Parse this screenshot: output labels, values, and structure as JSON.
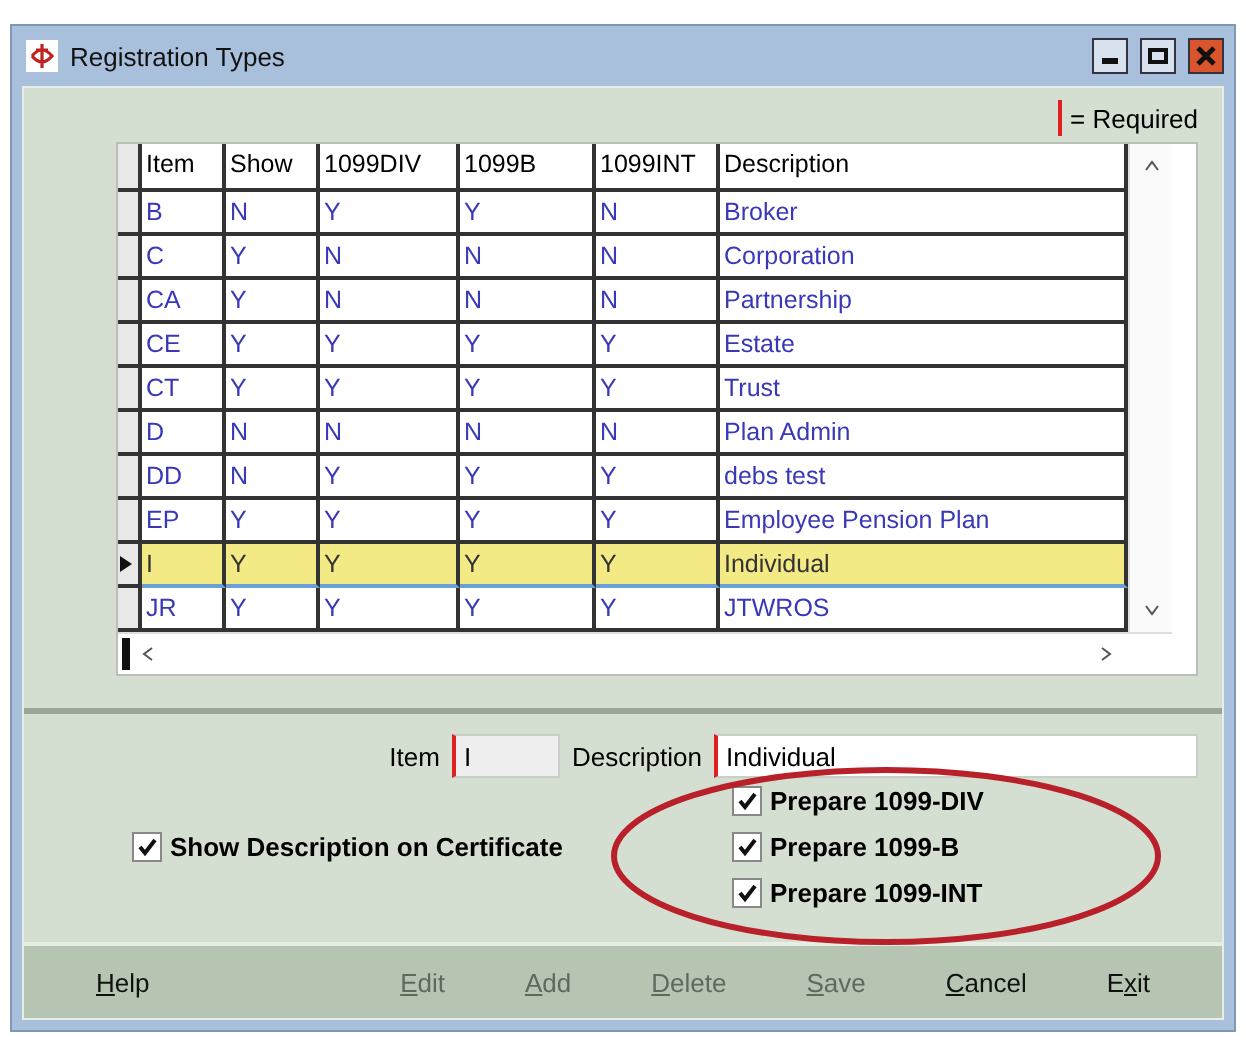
{
  "window": {
    "title": "Registration Types"
  },
  "legend": {
    "text": "= Required"
  },
  "table": {
    "columns": [
      "Item",
      "Show",
      "1099DIV",
      "1099B",
      "1099INT",
      "Description"
    ],
    "rows": [
      {
        "cells": [
          "B",
          "N",
          "Y",
          "Y",
          "N",
          "Broker"
        ],
        "selected": false
      },
      {
        "cells": [
          "C",
          "Y",
          "N",
          "N",
          "N",
          "Corporation"
        ],
        "selected": false
      },
      {
        "cells": [
          "CA",
          "Y",
          "N",
          "N",
          "N",
          "Partnership"
        ],
        "selected": false
      },
      {
        "cells": [
          "CE",
          "Y",
          "Y",
          "Y",
          "Y",
          "Estate"
        ],
        "selected": false
      },
      {
        "cells": [
          "CT",
          "Y",
          "Y",
          "Y",
          "Y",
          "Trust"
        ],
        "selected": false
      },
      {
        "cells": [
          "D",
          "N",
          "N",
          "N",
          "N",
          "Plan Admin"
        ],
        "selected": false
      },
      {
        "cells": [
          "DD",
          "N",
          "Y",
          "Y",
          "Y",
          "debs test"
        ],
        "selected": false
      },
      {
        "cells": [
          "EP",
          "Y",
          "Y",
          "Y",
          "Y",
          "Employee Pension Plan"
        ],
        "selected": false
      },
      {
        "cells": [
          "I",
          "Y",
          "Y",
          "Y",
          "Y",
          "Individual"
        ],
        "selected": true
      },
      {
        "cells": [
          "JR",
          "Y",
          "Y",
          "Y",
          "Y",
          "JTWROS"
        ],
        "selected": false
      }
    ]
  },
  "form": {
    "item": {
      "label": "Item",
      "value": "I"
    },
    "description": {
      "label": "Description",
      "value": "Individual"
    },
    "show_description": {
      "label": "Show Description on Certificate",
      "checked": true
    },
    "prepare": [
      {
        "label": "Prepare 1099-DIV",
        "checked": true
      },
      {
        "label": "Prepare 1099-B",
        "checked": true
      },
      {
        "label": "Prepare 1099-INT",
        "checked": true
      }
    ]
  },
  "buttons": [
    {
      "key": "H",
      "post": "elp",
      "disabled": false
    },
    {
      "key": "E",
      "post": "dit",
      "disabled": true
    },
    {
      "key": "A",
      "post": "dd",
      "disabled": true
    },
    {
      "key": "D",
      "post": "elete",
      "disabled": true
    },
    {
      "key": "S",
      "post": "ave",
      "disabled": true
    },
    {
      "key": "C",
      "post": "ancel",
      "disabled": false
    },
    {
      "pre": "E",
      "key": "x",
      "post": "it",
      "disabled": false
    }
  ]
}
